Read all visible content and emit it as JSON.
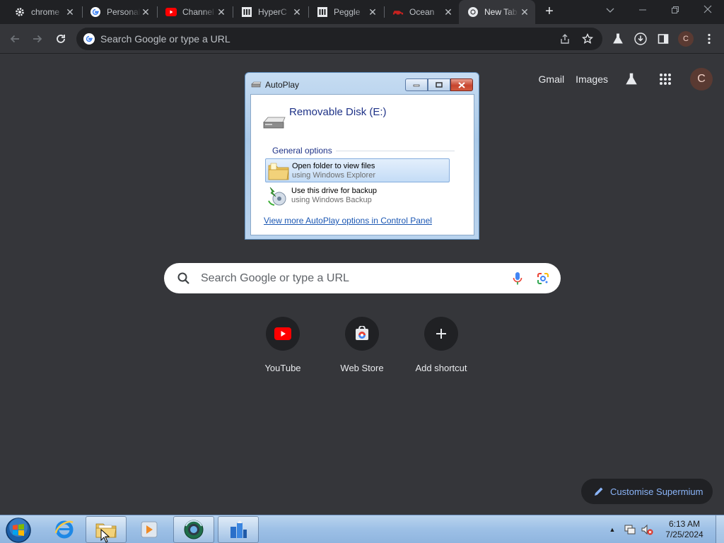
{
  "browser": {
    "tabs": [
      {
        "title": "chrome",
        "icon": "gear-icon"
      },
      {
        "title": "Personal",
        "icon": "google-g-icon"
      },
      {
        "title": "Channel",
        "icon": "youtube-icon"
      },
      {
        "title": "HyperC",
        "icon": "bank-icon"
      },
      {
        "title": "Peggle",
        "icon": "bank-icon"
      },
      {
        "title": "Ocean",
        "icon": "car-icon"
      },
      {
        "title": "New Tab",
        "icon": "chromium-icon",
        "active": true
      }
    ],
    "omnibox_placeholder": "Search Google or type a URL",
    "profile_initial": "C"
  },
  "ntp": {
    "links": {
      "gmail": "Gmail",
      "images": "Images"
    },
    "profile_initial": "C",
    "search_placeholder": "Search Google or type a URL",
    "shortcuts": [
      {
        "label": "YouTube",
        "icon": "youtube-icon"
      },
      {
        "label": "Web Store",
        "icon": "web-store-icon"
      },
      {
        "label": "Add shortcut",
        "icon": "plus-icon"
      }
    ],
    "customise_label": "Customise Supermium"
  },
  "autoplay": {
    "title": "AutoPlay",
    "drive_name": "Removable Disk (E:)",
    "group_label": "General options",
    "options": [
      {
        "line1": "Open folder to view files",
        "line2": "using Windows Explorer",
        "selected": true
      },
      {
        "line1": "Use this drive for backup",
        "line2": "using Windows Backup",
        "selected": false
      }
    ],
    "more_link": "View more AutoPlay options in Control Panel"
  },
  "taskbar": {
    "time": "6:13 AM",
    "date": "7/25/2024"
  },
  "colors": {
    "accent": "#8ab4f8",
    "frame": "#202124",
    "page": "#35363a"
  }
}
